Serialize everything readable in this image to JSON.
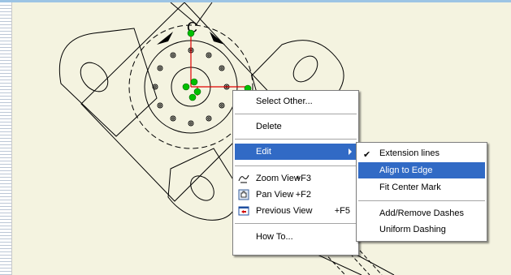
{
  "context_menu": {
    "select_other": "Select Other...",
    "delete": "Delete",
    "edit": "Edit",
    "zoom_view": "Zoom View",
    "zoom_view_shortcut": "+F3",
    "pan_view": "Pan View",
    "pan_view_shortcut": "+F2",
    "previous_view": "Previous View",
    "previous_view_shortcut": "+F5",
    "how_to": "How To..."
  },
  "edit_submenu": {
    "extension_lines": "Extension lines",
    "extension_lines_checked": true,
    "align_to_edge": "Align to Edge",
    "fit_center_mark": "Fit Center Mark",
    "add_remove_dashes": "Add/Remove Dashes",
    "uniform_dashing": "Uniform Dashing"
  },
  "drawing": {
    "rotate_label": "C"
  },
  "colors": {
    "highlight": "#316ac5",
    "canvas": "#f4f3e0",
    "center_mark": "#e00000",
    "handle": "#00c000"
  }
}
